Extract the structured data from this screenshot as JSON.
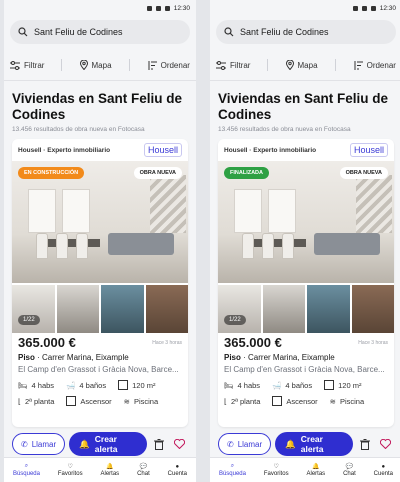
{
  "status": {
    "time": "12:30"
  },
  "search": {
    "query": "Sant Feliu de Codines"
  },
  "filters": {
    "filter_label": "Filtrar",
    "map_label": "Mapa",
    "sort_label": "Ordenar"
  },
  "results": {
    "title": "Viviendas en Sant Feliu de Codines",
    "subtitle": "13.456 resultados de obra nueva en Fotocasa"
  },
  "listing": {
    "agent_label": "Housell · Experto inmobiliario",
    "brand": "Housell",
    "new_badge": "OBRA NUEVA",
    "photo_counter": "1/22",
    "price": "365.000 €",
    "time_ago": "Hace 3 horas",
    "type": "Piso",
    "street": " · Carrer Marina, Eixample",
    "zone": "El Camp d'en Grassot i Gràcia Nova, Barce...",
    "features": {
      "rooms": "4 habs",
      "baths": "4 baños",
      "area": "120 m²",
      "floor": "2ª planta",
      "lift": "Ascensor",
      "pool": "Piscina"
    }
  },
  "screens": [
    {
      "status_badge": "EN CONSTRUCCIÓN",
      "status_color": "#f28a1a"
    },
    {
      "status_badge": "FINALIZADA",
      "status_color": "#2ea043"
    }
  ],
  "actions": {
    "call_label": "Llamar",
    "alert_label": "Crear alerta"
  },
  "nav": {
    "search": "Búsqueda",
    "favorites": "Favoritos",
    "alerts": "Alertas",
    "chat": "Chat",
    "account": "Cuenta"
  },
  "colors": {
    "accent": "#3b3ad6",
    "primary_button": "#2f2ed0"
  }
}
